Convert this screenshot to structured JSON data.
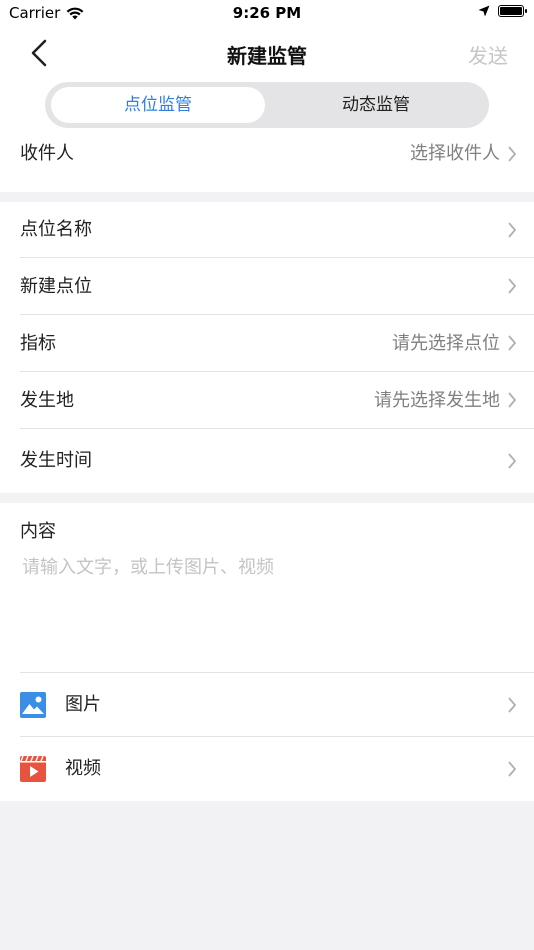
{
  "status_bar": {
    "carrier": "Carrier",
    "time": "9:26 PM"
  },
  "nav": {
    "title": "新建监管",
    "send_label": "发送"
  },
  "segments": [
    {
      "label": "点位监管",
      "active": true
    },
    {
      "label": "动态监管",
      "active": false
    }
  ],
  "recipient": {
    "label": "收件人",
    "value": "选择收件人"
  },
  "form_rows": [
    {
      "label": "点位名称",
      "value": ""
    },
    {
      "label": "新建点位",
      "value": ""
    },
    {
      "label": "指标",
      "value": "请先选择点位"
    },
    {
      "label": "发生地",
      "value": "请先选择发生地"
    },
    {
      "label": "发生时间",
      "value": ""
    }
  ],
  "content": {
    "label": "内容",
    "placeholder": "请输入文字，或上传图片、视频"
  },
  "media": {
    "image_label": "图片",
    "video_label": "视频"
  },
  "colors": {
    "accent": "#2f7fe0",
    "image_icon": "#3a8ee6",
    "video_icon": "#e8533f"
  }
}
